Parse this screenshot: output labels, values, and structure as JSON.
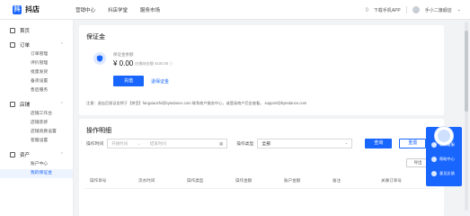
{
  "app": {
    "logo_mark": "抖",
    "name": "抖店"
  },
  "topnav": [
    "营销中心",
    "抖店学堂",
    "服务市场"
  ],
  "topright": {
    "download": "下载手机APP",
    "user": "手小二旗舰店"
  },
  "sidebar": {
    "home": "首页",
    "orders": {
      "label": "订单",
      "items": [
        "订单管理",
        "评价管理",
        "批量发货",
        "备货设置",
        "售后服务"
      ]
    },
    "store": {
      "label": "店铺",
      "items": [
        "店铺工作台",
        "店铺装修",
        "店铺资质设置",
        "客服设置"
      ]
    },
    "assets": {
      "label": "资产",
      "items": [
        "账户中心",
        "我的保证金"
      ],
      "active_index": 1
    }
  },
  "deposit": {
    "title": "保证金",
    "label": "保证金余额",
    "amount": "¥ 0.00",
    "note": "应缴纳金额 ¥100.00 ⓘ",
    "pay_button": "充值",
    "link": "退保证金",
    "contact": "注意：退店后保证金将于【拼音】fangxiaozhi@bytedance.com 联系商户服务中心，或登录商户后台查看。 support@bytedance.com"
  },
  "records": {
    "title": "操作明细",
    "time_label": "操作时间",
    "start_placeholder": "开始时间",
    "arrow": "→",
    "end_placeholder": "结束时间",
    "type_label": "操作类型",
    "type_value": "全部",
    "query_button": "查询",
    "reset_button": "重置",
    "export_button": "导出",
    "columns": [
      "操作单号",
      "流水时间",
      "操作类型",
      "操作金额",
      "账户金额",
      "备注",
      "关联订单号"
    ]
  },
  "float_panel": {
    "items": [
      "联系客服",
      "帮助中心",
      "意见反馈"
    ]
  },
  "colors": {
    "accent": "#1966ff",
    "background": "#f2f3f5"
  }
}
